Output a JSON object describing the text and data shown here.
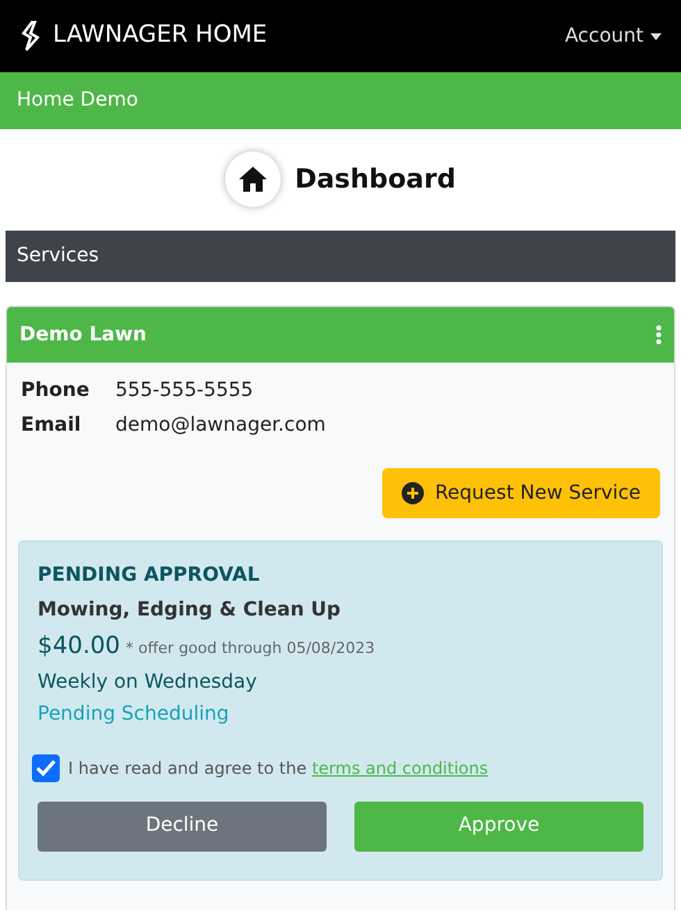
{
  "header": {
    "brand": "LAWNAGER HOME",
    "account_menu": "Account"
  },
  "breadcrumb": "Home Demo",
  "page_title": "Dashboard",
  "section": "Services",
  "property": {
    "name": "Demo Lawn",
    "details": [
      {
        "label": "Phone",
        "value": "555-555-5555"
      },
      {
        "label": "Email",
        "value": "demo@lawnager.com"
      }
    ]
  },
  "request_button": "Request New Service",
  "offer": {
    "status": "PENDING APPROVAL",
    "service": "Mowing, Edging & Clean Up",
    "price": "$40.00",
    "price_note": "* offer good through 05/08/2023",
    "frequency": "Weekly on Wednesday",
    "scheduling": "Pending Scheduling",
    "agreement": {
      "checked": true,
      "text": "I have read and agree to the ",
      "link": "terms and conditions"
    },
    "buttons": [
      {
        "kind": "decline",
        "label": "Decline"
      },
      {
        "kind": "approve",
        "label": "Approve"
      }
    ]
  }
}
